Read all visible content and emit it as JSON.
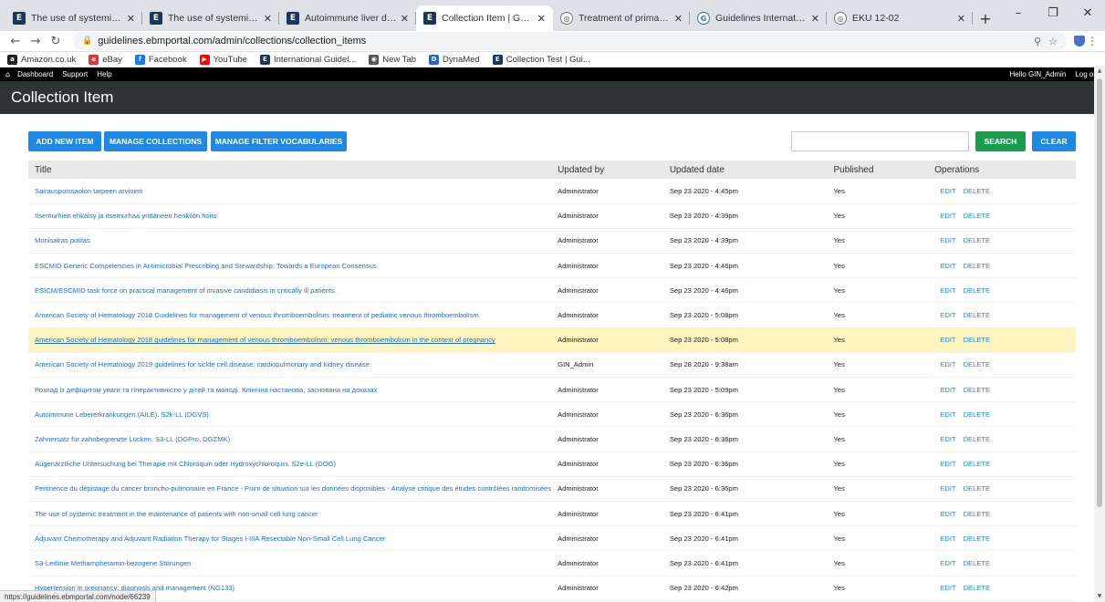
{
  "browser": {
    "tabs": [
      {
        "title": "The use of systemic treatment in",
        "icon": "E"
      },
      {
        "title": "The use of systemic treatment in",
        "icon": "E"
      },
      {
        "title": "Autoimmune liver disease (AILE)",
        "icon": "E"
      },
      {
        "title": "Collection Item | Guidelines Inter",
        "icon": "E",
        "active": true
      },
      {
        "title": "Treatment of primary breast canc",
        "icon": "globe"
      },
      {
        "title": "Guidelines International Network",
        "icon": "gin"
      },
      {
        "title": "EKU 12-02",
        "icon": "globe"
      }
    ],
    "url": "guidelines.ebmportal.com/admin/collections/collection_items",
    "bookmarks": [
      {
        "label": "Amazon.co.uk",
        "color": "#222",
        "glyph": "a"
      },
      {
        "label": "eBay",
        "color": "#e53238",
        "glyph": "e"
      },
      {
        "label": "Facebook",
        "color": "#1877f2",
        "glyph": "f"
      },
      {
        "label": "YouTube",
        "color": "#ff0000",
        "glyph": "▶"
      },
      {
        "label": "International Guidel...",
        "color": "#1d3557",
        "glyph": "E"
      },
      {
        "label": "New Tab",
        "color": "#555",
        "glyph": "◉"
      },
      {
        "label": "DynaMed",
        "color": "#2a60c8",
        "glyph": "D"
      },
      {
        "label": "Collection Test | Gui...",
        "color": "#1d3557",
        "glyph": "E"
      }
    ],
    "status_url": "https://guidelines.ebmportal.com/node/66239"
  },
  "adminbar": {
    "links": [
      "Dashboard",
      "Support",
      "Help"
    ],
    "greeting": "Hello GIN_Admin",
    "logout": "Log out"
  },
  "page": {
    "title": "Collection Item",
    "buttons": {
      "add_new": "ADD NEW ITEM",
      "manage_collections": "MANAGE COLLECTIONS",
      "manage_vocab": "MANAGE FILTER VOCABULARIES",
      "search": "SEARCH",
      "clear": "CLEAR"
    },
    "search_value": ""
  },
  "table": {
    "columns": [
      "Title",
      "Updated by",
      "Updated date",
      "Published",
      "Operations"
    ],
    "op_edit": "EDIT",
    "op_delete": "DELETE",
    "rows": [
      {
        "title": "Sairauspoissaolon tarpeen arviointi",
        "by": "Administrator",
        "date": "Sep 23 2020 - 4:45pm",
        "published": "Yes"
      },
      {
        "title": "Itsemurhien ehkäisy ja itsemurhaa yrittäneen henkilön hoito",
        "by": "Administrator",
        "date": "Sep 23 2020 - 4:39pm",
        "published": "Yes"
      },
      {
        "title": "Monisairas potilas",
        "by": "Administrator",
        "date": "Sep 23 2020 - 4:39pm",
        "published": "Yes"
      },
      {
        "title": "ESCMID Generic Competencies in Antimicrobial Prescribing and Stewardship: Towards a European Consensus",
        "by": "Administrator",
        "date": "Sep 23 2020 - 4:46pm",
        "published": "Yes"
      },
      {
        "title": "ESICM/ESCMID task force on practical management of invasive candidiasis in critically ill patients.",
        "by": "Administrator",
        "date": "Sep 23 2020 - 4:46pm",
        "published": "Yes"
      },
      {
        "title": "American Society of Hematology 2018 Guidelines for management of venous thromboembolism: treatment of pediatric venous thromboembolism",
        "by": "Administrator",
        "date": "Sep 23 2020 - 5:08pm",
        "published": "Yes"
      },
      {
        "title": "American Society of Hematology 2018 guidelines for management of venous thromboembolism: venous thromboembolism in the context of pregnancy",
        "by": "Administrator",
        "date": "Sep 23 2020 - 5:08pm",
        "published": "Yes",
        "highlight": true
      },
      {
        "title": "American Society of Hematology 2019 guidelines for sickle cell disease: cardiopulmonary and kidney disease",
        "by": "GIN_Admin",
        "date": "Sep 28 2020 - 9:38am",
        "published": "Yes"
      },
      {
        "title": "Розлад із дефіцитом уваги та гіперактивністю у дітей та молоді. Клінічна настанова, заснована на доказах",
        "by": "Administrator",
        "date": "Sep 23 2020 - 5:09pm",
        "published": "Yes"
      },
      {
        "title": "Autoimmune Lebererkrankungen (AILE). S2k-LL (DGVS)",
        "by": "Administrator",
        "date": "Sep 23 2020 - 6:36pm",
        "published": "Yes"
      },
      {
        "title": "Zahnersatz für zahnbegrenzte Lücken. S3-LL (DGPro, DGZMK)",
        "by": "Administrator",
        "date": "Sep 23 2020 - 6:36pm",
        "published": "Yes"
      },
      {
        "title": "Augenärztliche Untersuchung bei Therapie mit Chloroquin oder Hydroxychloroquin. S2e-LL (DOG)",
        "by": "Administrator",
        "date": "Sep 23 2020 - 6:36pm",
        "published": "Yes"
      },
      {
        "title": "Pertinence du dépistage du cancer broncho-pulmonaire en France - Point de situation sur les données disponibles - Analyse critique des études contrôlées randomisées",
        "by": "Administrator",
        "date": "Sep 23 2020 - 6:36pm",
        "published": "Yes"
      },
      {
        "title": "The use of systemic treatment in the maintenance of patients with non-small cell lung cancer",
        "by": "Administrator",
        "date": "Sep 23 2020 - 6:41pm",
        "published": "Yes"
      },
      {
        "title": "Adjuvant Chemotherapy and Adjuvant Radiation Therapy for Stages I-IIIA Resectable Non-Small Cell Lung Cancer",
        "by": "Administrator",
        "date": "Sep 23 2020 - 6:41pm",
        "published": "Yes"
      },
      {
        "title": "S3-Leitlinie Methamphetamin-bezogene Störungen",
        "by": "Administrator",
        "date": "Sep 23 2020 - 6:41pm",
        "published": "Yes"
      },
      {
        "title": "Hypertension in pregnancy: diagnosis and management (NG133)",
        "by": "Administrator",
        "date": "Sep 23 2020 - 6:42pm",
        "published": "Yes"
      }
    ]
  }
}
